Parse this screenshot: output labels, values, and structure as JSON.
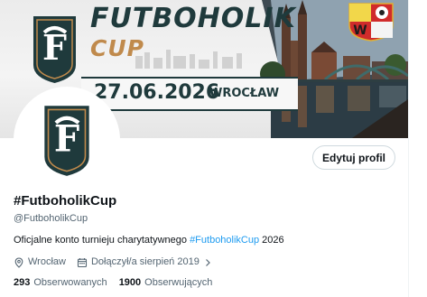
{
  "banner": {
    "title": "FUTBOHOLIK",
    "subtitle": "CUP",
    "date": "27.06.2026",
    "city": "WROCŁAW"
  },
  "profile": {
    "edit_button_label": "Edytuj profil",
    "display_name": "#FutboholikCup",
    "handle": "@FutboholikCup",
    "bio_before": "Oficjalne konto turnieju charytatywnego ",
    "bio_hashtag": "#FutboholikCup",
    "bio_after": " 2026",
    "location": "Wrocław",
    "joined": "Dołączył/a sierpień 2019",
    "following_count": "293",
    "following_label": "Obserwowanych",
    "followers_count": "1900",
    "followers_label": "Obserwujących"
  },
  "icons": {
    "location": "location-pin-icon",
    "joined": "calendar-icon",
    "joined_chevron": "chevron-right-icon"
  },
  "colors": {
    "link": "#1d9bf0",
    "secondary_text": "#536471",
    "brand_dark": "#1f3a3c",
    "brand_gold": "#c08a4c"
  }
}
